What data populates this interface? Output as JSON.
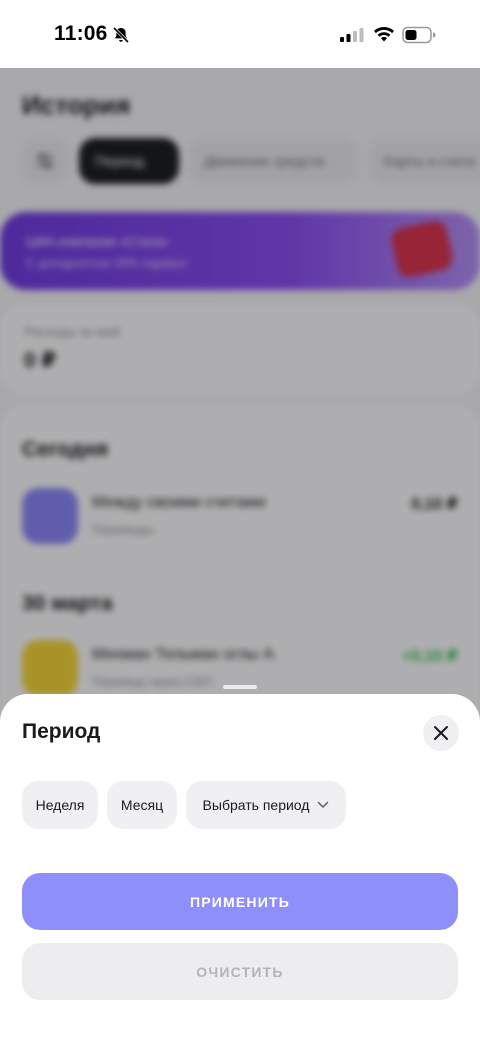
{
  "status_bar": {
    "time": "11:06",
    "icons": [
      "bell-slash-icon",
      "signal-icon",
      "wifi-icon",
      "battery-icon"
    ]
  },
  "background": {
    "title": "История",
    "filters": [
      "Период",
      "Движение средств",
      "Карты и счета"
    ],
    "banner": {
      "title": "ЦФА компании «Стата»",
      "subtitle": "С доходностью 20% годовых"
    },
    "expenses": {
      "label": "Расходы за май",
      "value": "0 ₽"
    },
    "sections": [
      {
        "title": "Сегодня",
        "transactions": [
          {
            "title": "Между своими счетами",
            "subtitle": "Переводы",
            "amount": "0,10 ₽"
          }
        ]
      },
      {
        "title": "30 марта",
        "transactions": [
          {
            "title": "Мехман Тельман оглы А.",
            "subtitle": "Перевод через СБП",
            "amount": "+0,10 ₽"
          }
        ]
      }
    ]
  },
  "sheet": {
    "title": "Период",
    "options": {
      "week": "Неделя",
      "month": "Месяц",
      "custom": "Выбрать период"
    },
    "apply_label": "ПРИМЕНИТЬ",
    "clear_label": "ОЧИСТИТЬ"
  },
  "colors": {
    "accent": "#8f8ffb",
    "banner": "#7a45e6",
    "positive": "#2fbf4d",
    "sheet_chip": "#f0f0f3"
  }
}
